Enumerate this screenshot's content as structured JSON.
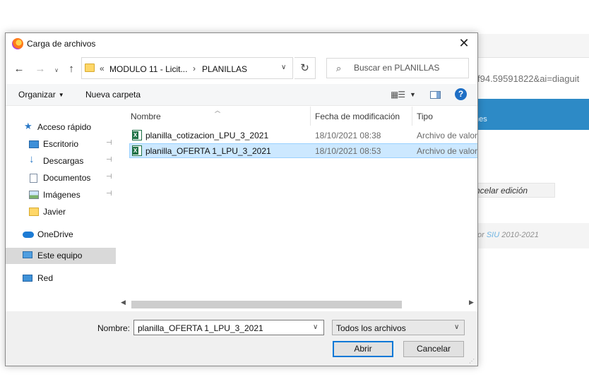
{
  "background": {
    "url_fragment": "f94.59591822&ai=diaguit",
    "band_text": "nes",
    "cancel_edit": "ncelar edición",
    "footer_prefix": "or",
    "footer_brand": "SIU",
    "footer_years": "2010-2021"
  },
  "dialog": {
    "title": "Carga de archivos",
    "close_glyph": "✕",
    "address": {
      "overflow_glyph": "«",
      "crumbs": [
        "MODULO 11 - Licit...",
        "PLANILLAS"
      ],
      "separator": "›"
    },
    "search": {
      "placeholder": "Buscar en PLANILLAS"
    },
    "toolbar": {
      "organize_label": "Organizar",
      "new_folder_label": "Nueva carpeta",
      "help_glyph": "?"
    },
    "nav_pane": {
      "items": [
        {
          "label": "Acceso rápido",
          "icon": "star-icon"
        },
        {
          "label": "Escritorio",
          "icon": "desktop-icon",
          "pinned": true
        },
        {
          "label": "Descargas",
          "icon": "download-icon",
          "pinned": true
        },
        {
          "label": "Documentos",
          "icon": "documents-icon",
          "pinned": true
        },
        {
          "label": "Imágenes",
          "icon": "images-icon",
          "pinned": true
        },
        {
          "label": "Javier",
          "icon": "folder-icon"
        },
        {
          "label": "OneDrive",
          "icon": "cloud-icon"
        },
        {
          "label": "Este equipo",
          "icon": "computer-icon",
          "selected": true
        },
        {
          "label": "Red",
          "icon": "network-icon"
        }
      ]
    },
    "file_list": {
      "columns": [
        "Nombre",
        "Fecha de modificación",
        "Tipo"
      ],
      "files": [
        {
          "name": "planilla_cotizacion_LPU_3_2021",
          "modified": "18/10/2021 08:38",
          "type": "Archivo de valor",
          "icon": "excel-icon"
        },
        {
          "name": "planilla_OFERTA 1_LPU_3_2021",
          "modified": "18/10/2021 08:53",
          "type": "Archivo de valor",
          "icon": "excel-icon",
          "selected": true
        }
      ]
    },
    "footer": {
      "name_label": "Nombre:",
      "name_value": "planilla_OFERTA 1_LPU_3_2021",
      "filetype_value": "Todos los archivos",
      "open_label": "Abrir",
      "cancel_label": "Cancelar"
    },
    "colors": {
      "selection": "#cce8ff",
      "selection_border": "#99d1ff",
      "accent": "#0078d7",
      "background_band": "#2d8ac6"
    }
  }
}
